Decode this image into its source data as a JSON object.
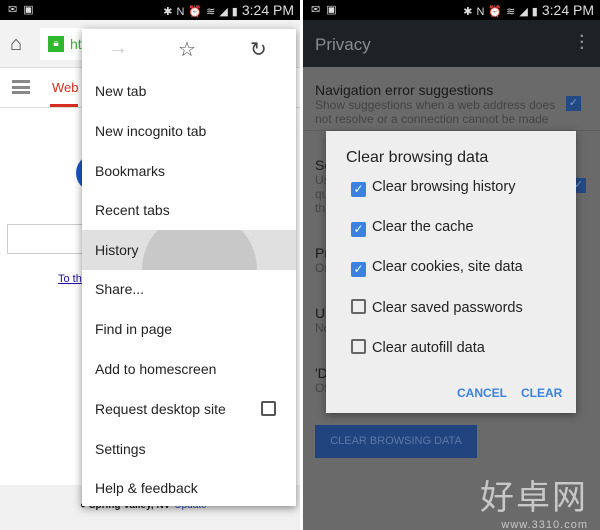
{
  "status": {
    "time": "3:24 PM",
    "icons": [
      "mail-icon",
      "image-icon",
      "bluetooth-icon",
      "nfc-icon",
      "alarm-icon",
      "wifi-icon",
      "signal-icon",
      "battery-icon"
    ]
  },
  "left": {
    "url_fragment": "ht",
    "tab_web": "Web",
    "link_fragment": "To th",
    "location": "Spring Valley, NV",
    "update": "Update",
    "menu": {
      "items": [
        "New tab",
        "New incognito tab",
        "Bookmarks",
        "Recent tabs",
        "History",
        "Share...",
        "Find in page",
        "Add to homescreen",
        "Request desktop site",
        "Settings",
        "Help & feedback"
      ],
      "request_desktop_checked": false,
      "highlighted": "History"
    }
  },
  "right": {
    "title": "Privacy",
    "pref1": {
      "title": "Navigation error suggestions",
      "summary": "Show suggestions when a web address does not resolve or a connection cannot be made",
      "checked": true
    },
    "bg_fragments": [
      "Se",
      "Us",
      "qu",
      "th",
      "Pr",
      "Or",
      "Us",
      "No",
      "'D",
      "Of"
    ],
    "dialog": {
      "title": "Clear browsing data",
      "options": [
        {
          "label": "Clear browsing history",
          "checked": true
        },
        {
          "label": "Clear the cache",
          "checked": true
        },
        {
          "label": "Clear cookies, site data",
          "checked": true
        },
        {
          "label": "Clear saved passwords",
          "checked": false
        },
        {
          "label": "Clear autofill data",
          "checked": false
        }
      ],
      "cancel": "CANCEL",
      "clear": "CLEAR"
    },
    "clear_button": "CLEAR BROWSING DATA",
    "watermark": {
      "cn": "好卓网",
      "url": "www.3310.com"
    }
  },
  "colors": {
    "accent": "#3b82e0",
    "google_red": "#d62d20",
    "lock_green": "#2eb82e"
  }
}
